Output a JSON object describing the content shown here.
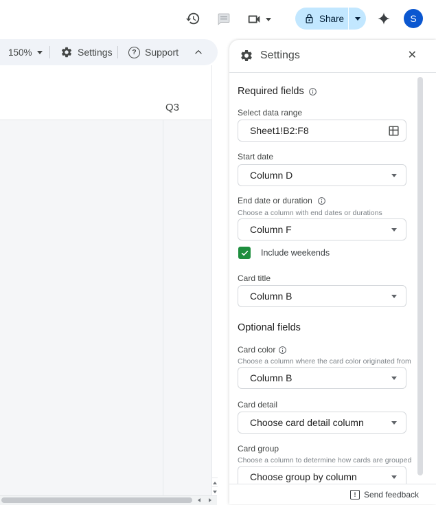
{
  "topbar": {
    "share": {
      "label": "Share"
    },
    "avatar": {
      "initial": "S"
    }
  },
  "toolbar": {
    "zoom_level": "150%",
    "settings_label": "Settings",
    "support_label": "Support"
  },
  "timeline": {
    "quarter": "Q3"
  },
  "panel": {
    "title": "Settings",
    "close_glyph": "✕",
    "sections": {
      "required": {
        "heading": "Required fields"
      },
      "data_range": {
        "label": "Select data range",
        "value": "Sheet1!B2:F8"
      },
      "start_date": {
        "label": "Start date",
        "value": "Column D"
      },
      "end_date": {
        "label": "End date or duration",
        "helper": "Choose a column with end dates or durations",
        "value": "Column F"
      },
      "include_weekends": {
        "label": "Include weekends",
        "checked": true
      },
      "card_title": {
        "label": "Card title",
        "value": "Column B"
      },
      "optional": {
        "heading": "Optional fields"
      },
      "card_color": {
        "label": "Card color",
        "helper": "Choose a column where the card color originated from",
        "value": "Column B"
      },
      "card_detail": {
        "label": "Card detail",
        "value": "Choose card detail column"
      },
      "card_group": {
        "label": "Card group",
        "helper": "Choose a column to determine how cards are grouped",
        "value": "Choose group by column"
      }
    }
  },
  "footer": {
    "send_feedback": "Send feedback"
  },
  "icons": {
    "version_history": "clock-with-counterclockwise-arrow",
    "comments": "speech-bubble",
    "meet_camera": "video-camera",
    "share_lock": "padlock",
    "gemini": "four-point-sparkle",
    "settings_gear": "gear",
    "support_help": "question-circle",
    "info": "info-circle",
    "data_range_picker": "grid",
    "feedback": "exclamation-square"
  },
  "colors": {
    "share_pill": "#c2e7ff",
    "share_text": "#001d35",
    "avatar": "#0b57d0",
    "checkbox_green": "#1e8e3e",
    "toolbar_bg": "#f0f3f8",
    "canvas_bg": "#f5f6f8"
  }
}
